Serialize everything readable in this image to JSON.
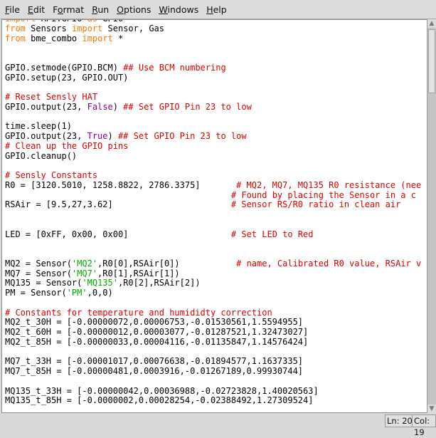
{
  "menu": [
    {
      "label": "File",
      "u": "F"
    },
    {
      "label": "Edit",
      "u": "E"
    },
    {
      "label": "Format",
      "u": "o"
    },
    {
      "label": "Run",
      "u": "R"
    },
    {
      "label": "Options",
      "u": "O"
    },
    {
      "label": "Windows",
      "u": "W"
    },
    {
      "label": "Help",
      "u": "H"
    }
  ],
  "colors": {
    "keyword": "#ff7700",
    "comment": "#dd0000",
    "string": "#00aa00",
    "builtin": "#900090"
  },
  "code_lines": [
    [
      [
        "k",
        "import"
      ],
      [
        "n",
        " RPi.GPIO "
      ],
      [
        "k",
        "as"
      ],
      [
        "n",
        " GPIO"
      ]
    ],
    [
      [
        "k",
        "from"
      ],
      [
        "n",
        " Sensors "
      ],
      [
        "k",
        "import"
      ],
      [
        "n",
        " Sensor, Gas"
      ]
    ],
    [
      [
        "k",
        "from"
      ],
      [
        "n",
        " bme_combo "
      ],
      [
        "k",
        "import"
      ],
      [
        "n",
        " *"
      ]
    ],
    [],
    [],
    [
      [
        "n",
        "GPIO.setmode(GPIO.BCM) "
      ],
      [
        "c",
        "## Use BCM numbering"
      ]
    ],
    [
      [
        "n",
        "GPIO.setup(23, GPIO.OUT)"
      ]
    ],
    [],
    [
      [
        "c",
        "# Reset Sensly HAT"
      ]
    ],
    [
      [
        "n",
        "GPIO.output(23, "
      ],
      [
        "b",
        "False"
      ],
      [
        "n",
        ") "
      ],
      [
        "c",
        "## Set GPIO Pin 23 to low"
      ]
    ],
    [],
    [
      [
        "n",
        "time.sleep(1)"
      ]
    ],
    [
      [
        "n",
        "GPIO.output(23, "
      ],
      [
        "b",
        "True"
      ],
      [
        "n",
        ") "
      ],
      [
        "c",
        "## Set GPIO Pin 23 to low"
      ]
    ],
    [
      [
        "c",
        "# Clean up the GPIO pins"
      ]
    ],
    [
      [
        "n",
        "GPIO.cleanup()"
      ]
    ],
    [],
    [
      [
        "c",
        "# Sensly Constants"
      ]
    ],
    [
      [
        "n",
        "R0 = [3120.5010, 1258.8822, 2786.3375]       "
      ],
      [
        "c",
        "# MQ2, MQ7, MQ135 R0 resistance (nee"
      ]
    ],
    [
      [
        "n",
        "                                            "
      ],
      [
        "c",
        "# Found by placing the Sensor in a c"
      ]
    ],
    [
      [
        "n",
        "RSAir = [9.5,27,3.62]                       "
      ],
      [
        "c",
        "# Sensor RS/R0 ratio in clean air"
      ]
    ],
    [],
    [],
    [
      [
        "n",
        "LED = [0xFF, 0x00, 0x00]                    "
      ],
      [
        "c",
        "# Set LED to Red"
      ]
    ],
    [],
    [],
    [
      [
        "n",
        "MQ2 = Sensor("
      ],
      [
        "s",
        "'MQ2'"
      ],
      [
        "n",
        ",R0[0],RSAir[0])           "
      ],
      [
        "c",
        "# name, Calibrated R0 value, RSAir v"
      ]
    ],
    [
      [
        "n",
        "MQ7 = Sensor("
      ],
      [
        "s",
        "'MQ7'"
      ],
      [
        "n",
        ",R0[1],RSAir[1])"
      ]
    ],
    [
      [
        "n",
        "MQ135 = Sensor("
      ],
      [
        "s",
        "'MQ135'"
      ],
      [
        "n",
        ",R0[2],RSAir[2])"
      ]
    ],
    [
      [
        "n",
        "PM = Sensor("
      ],
      [
        "s",
        "'PM'"
      ],
      [
        "n",
        ",0,0)"
      ]
    ],
    [],
    [
      [
        "c",
        "# Constants for temperature and humididty correction"
      ]
    ],
    [
      [
        "n",
        "MQ2_t_30H = [-0.00000072,0.00006753,-0.01530561,1.5594955]"
      ]
    ],
    [
      [
        "n",
        "MQ2_t_60H = [-0.00000012,0.00003077,-0.01287521,1.32473027]"
      ]
    ],
    [
      [
        "n",
        "MQ2_t_85H = [-0.00000033,0.00004116,-0.01135847,1.14576424]"
      ]
    ],
    [],
    [
      [
        "n",
        "MQ7_t_33H = [-0.00001017,0.00076638,-0.01894577,1.1637335]"
      ]
    ],
    [
      [
        "n",
        "MQ7_t_85H = [-0.00000481,0.0003916,-0.01267189,0.99930744]"
      ]
    ],
    [],
    [
      [
        "n",
        "MQ135_t_33H = [-0.00000042,0.00036988,-0.02723828,1.40020563]"
      ]
    ],
    [
      [
        "n",
        "MQ135_t_85H = [-0.0000002,0.00028254,-0.02388492,1.27309524]"
      ]
    ]
  ],
  "status": {
    "line": "Ln: 20",
    "col": "Col: 19"
  }
}
